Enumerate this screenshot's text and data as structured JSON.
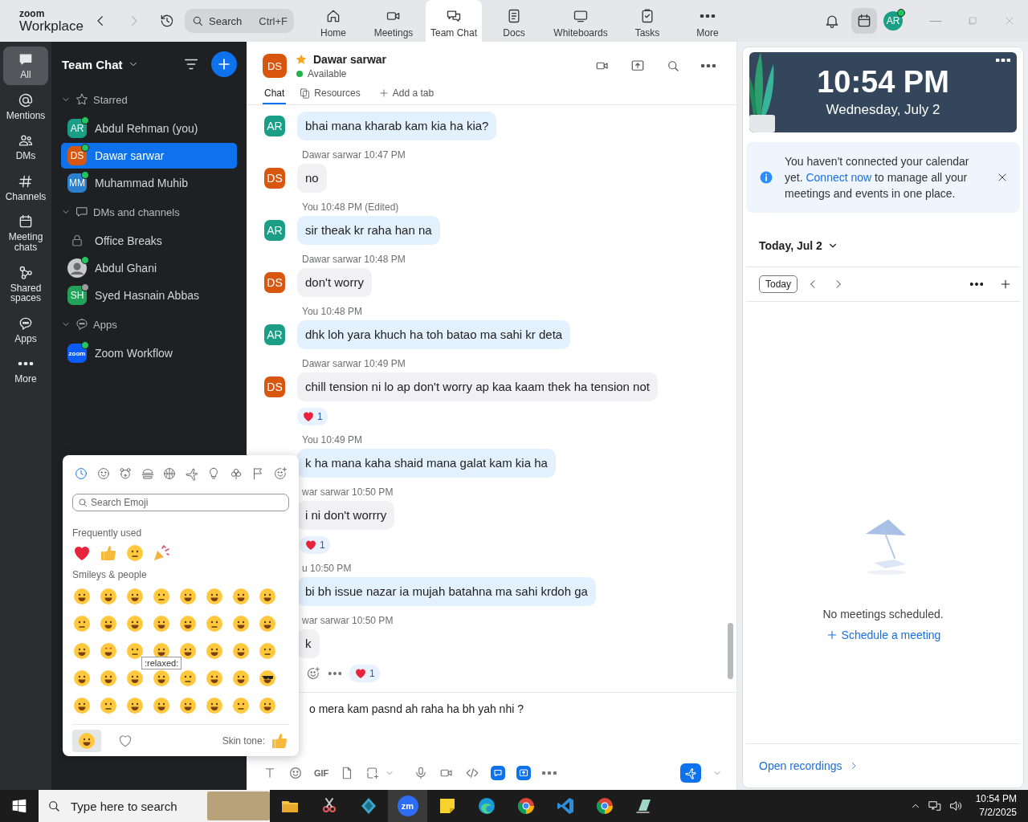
{
  "app": {
    "brand_small": "zoom",
    "brand": "Workplace"
  },
  "search": {
    "placeholder": "Search",
    "shortcut": "Ctrl+F"
  },
  "nav_tabs": [
    {
      "label": "Home",
      "selected": false
    },
    {
      "label": "Meetings",
      "selected": false
    },
    {
      "label": "Team Chat",
      "selected": true
    },
    {
      "label": "Docs",
      "selected": false
    },
    {
      "label": "Whiteboards",
      "selected": false
    },
    {
      "label": "Tasks",
      "selected": false
    },
    {
      "label": "More",
      "selected": false
    }
  ],
  "account": {
    "initials": "AR",
    "color": "#1a9e86",
    "online": true
  },
  "rail": [
    {
      "label": "All",
      "selected": true
    },
    {
      "label": "Mentions",
      "selected": false
    },
    {
      "label": "DMs",
      "selected": false
    },
    {
      "label": "Channels",
      "selected": false
    },
    {
      "label": "Meeting chats",
      "selected": false
    },
    {
      "label": "Shared spaces",
      "selected": false
    },
    {
      "label": "Apps",
      "selected": false
    },
    {
      "label": "More",
      "selected": false
    }
  ],
  "sidebar": {
    "title": "Team Chat",
    "sections": [
      {
        "label": "Starred",
        "expanded": true,
        "items": [
          {
            "name": "Abdul Rehman (you)",
            "avatar": {
              "kind": "initials",
              "text": "AR",
              "color": "#1a9e86"
            },
            "online": true,
            "selected": false
          },
          {
            "name": "Dawar sarwar",
            "avatar": {
              "kind": "initials",
              "text": "DS",
              "color": "#d9560f"
            },
            "online": true,
            "selected": true
          },
          {
            "name": "Muhammad Muhib",
            "avatar": {
              "kind": "initials",
              "text": "MM",
              "color": "#2d7fd0"
            },
            "online": true,
            "selected": false
          }
        ]
      },
      {
        "label": "DMs and channels",
        "expanded": true,
        "items": [
          {
            "name": "Office Breaks",
            "avatar": {
              "kind": "lock"
            },
            "selected": false
          },
          {
            "name": "Abdul Ghani",
            "avatar": {
              "kind": "photo"
            },
            "online": true,
            "selected": false
          },
          {
            "name": "Syed Hasnain Abbas",
            "avatar": {
              "kind": "initials",
              "text": "SH",
              "color": "#22a35a"
            },
            "online": false,
            "selected": false
          }
        ]
      },
      {
        "label": "Apps",
        "expanded": true,
        "items": [
          {
            "name": "Zoom Workflow",
            "avatar": {
              "kind": "app",
              "text": "zoom",
              "color": "#0b5cff"
            },
            "online": true,
            "selected": false
          }
        ]
      }
    ]
  },
  "chat": {
    "contact": {
      "initials": "DS",
      "color": "#d9560f",
      "name": "Dawar sarwar",
      "starred": true,
      "status": "Available"
    },
    "tabs": [
      {
        "kind": "plain",
        "label": "Chat",
        "selected": true
      },
      {
        "kind": "documents",
        "label": "Resources",
        "selected": false
      },
      {
        "kind": "add",
        "label": "Add a tab",
        "selected": false
      }
    ],
    "messages": [
      {
        "mine": true,
        "initials": "AR",
        "color": "#1a9e86",
        "text": "bhai mana kharab kam kia ha kia?"
      },
      {
        "mine": false,
        "initials": "DS",
        "color": "#d9560f",
        "meta": "Dawar sarwar 10:47 PM",
        "text": "no"
      },
      {
        "mine": true,
        "initials": "AR",
        "color": "#1a9e86",
        "meta": "You 10:48 PM (Edited)",
        "text": "sir theak kr raha han na"
      },
      {
        "mine": false,
        "initials": "DS",
        "color": "#d9560f",
        "meta": "Dawar sarwar 10:48 PM",
        "text": "don't worry"
      },
      {
        "mine": true,
        "initials": "AR",
        "color": "#1a9e86",
        "meta": "You 10:48 PM",
        "text": "dhk loh yara khuch ha toh batao ma sahi kr deta"
      },
      {
        "mine": false,
        "initials": "DS",
        "color": "#d9560f",
        "meta": "Dawar sarwar 10:49 PM",
        "text": "chill tension ni lo ap don't worry ap kaa kaam thek ha tension not",
        "reaction": "1"
      },
      {
        "mine": true,
        "meta": "You 10:49 PM",
        "text": "k ha mana kaha shaid mana galat kam kia ha"
      },
      {
        "mine": false,
        "meta": "war sarwar 10:50 PM",
        "text": "i ni don't worrry",
        "reaction": "1"
      },
      {
        "mine": true,
        "meta": "u 10:50 PM",
        "text": "bi bh issue nazar ia mujah batahna ma sahi krdoh ga"
      },
      {
        "mine": false,
        "meta": "war sarwar 10:50 PM",
        "text": "k",
        "actions": true,
        "reaction": "1"
      }
    ],
    "composer": {
      "value": "o mera kam pasnd ah raha ha bh yah nhi ?",
      "gif": "GIF"
    }
  },
  "emoji_picker": {
    "categories": [
      {
        "selected": true
      },
      {
        "selected": false
      },
      {
        "selected": false
      },
      {
        "selected": false
      },
      {
        "selected": false
      },
      {
        "selected": false
      },
      {
        "selected": false
      },
      {
        "selected": false
      },
      {
        "selected": false
      },
      {
        "selected": false
      }
    ],
    "search_placeholder": "Search Emoji",
    "frequent_title": "Frequently used",
    "smileys_title": "Smileys & people",
    "tooltip": ":relaxed:",
    "skin_tone": "Skin tone:",
    "footer_tabs": [
      {
        "selected": true
      },
      {
        "selected": false
      }
    ]
  },
  "calendar": {
    "time": "10:54 PM",
    "date": "Wednesday, July 2",
    "notice": {
      "before": "You haven't connected your calendar yet.",
      "link": "Connect now",
      "after": "to manage all your meetings and events in one place."
    },
    "day": "Today, Jul 2",
    "today_button": "Today",
    "empty": "No meetings scheduled.",
    "schedule": "Schedule a meeting",
    "recordings": "Open recordings"
  },
  "taskbar": {
    "search_placeholder": "Type here to search",
    "apps": [
      {
        "kind": "explorer",
        "selected": false
      },
      {
        "kind": "snip",
        "selected": false
      },
      {
        "kind": "gem",
        "selected": false
      },
      {
        "kind": "zoom",
        "label": "zm",
        "selected": true
      },
      {
        "kind": "notes",
        "selected": false
      },
      {
        "kind": "edge",
        "selected": false
      },
      {
        "kind": "chrome",
        "selected": false
      },
      {
        "kind": "vscode",
        "selected": false
      },
      {
        "kind": "chrome",
        "selected": false
      },
      {
        "kind": "glass",
        "selected": false
      }
    ],
    "time": "10:54 PM",
    "date": "7/2/2025"
  }
}
